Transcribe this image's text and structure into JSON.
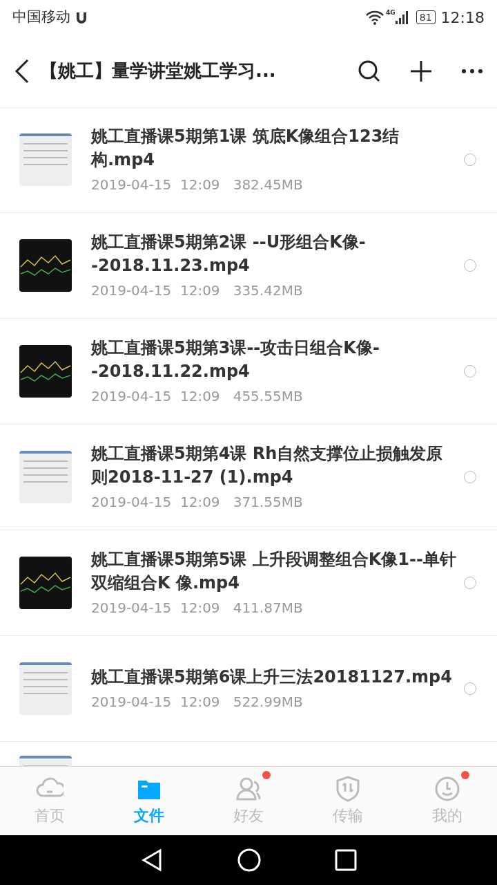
{
  "status_bar": {
    "carrier": "中国移动",
    "network": "4G",
    "battery": "81",
    "time": "12:18"
  },
  "header": {
    "title": "【姚工】量学讲堂姚工学习..."
  },
  "files": [
    {
      "name": "姚工直播课5期第1课 筑底K像组合123结构.mp4",
      "date": "2019-04-15",
      "time": "12:09",
      "size": "382.45MB",
      "kind": "document",
      "checked": false
    },
    {
      "name": "姚工直播课5期第2课 --U形组合K像--2018.11.23.mp4",
      "date": "2019-04-15",
      "time": "12:09",
      "size": "335.42MB",
      "kind": "chart",
      "checked": false
    },
    {
      "name": "姚工直播课5期第3课--攻击日组合K像--2018.11.22.mp4",
      "date": "2019-04-15",
      "time": "12:09",
      "size": "455.55MB",
      "kind": "chart",
      "checked": false
    },
    {
      "name": "姚工直播课5期第4课 Rh自然支撑位止损触发原则2018-11-27 (1).mp4",
      "date": "2019-04-15",
      "time": "12:09",
      "size": "371.55MB",
      "kind": "document",
      "checked": false
    },
    {
      "name": "姚工直播课5期第5课 上升段调整组合K像1--单针双缩组合K 像.mp4",
      "date": "2019-04-15",
      "time": "12:09",
      "size": "411.87MB",
      "kind": "chart",
      "checked": false
    },
    {
      "name": "姚工直播课5期第6课上升三法20181127.mp4",
      "date": "2019-04-15",
      "time": "12:09",
      "size": "522.99MB",
      "kind": "document",
      "checked": false
    }
  ],
  "partial_row": {
    "kind": "document"
  },
  "tabs": [
    {
      "label": "首页",
      "kind": "cloud",
      "selected": false,
      "badge": false
    },
    {
      "label": "文件",
      "kind": "folder",
      "selected": true,
      "badge": false
    },
    {
      "label": "好友",
      "kind": "friends",
      "selected": false,
      "badge": true
    },
    {
      "label": "传输",
      "kind": "transfer",
      "selected": false,
      "badge": false
    },
    {
      "label": "我的",
      "kind": "me",
      "selected": false,
      "badge": true
    }
  ]
}
